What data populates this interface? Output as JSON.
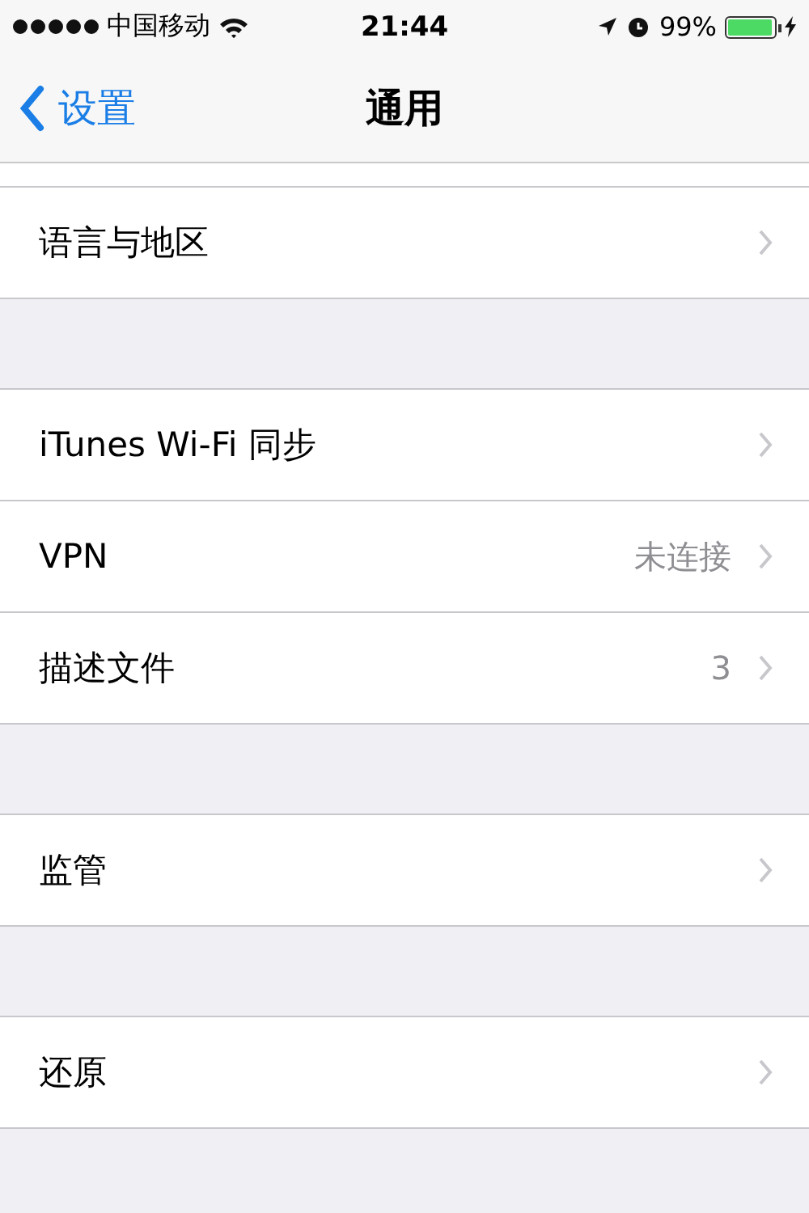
{
  "status_bar": {
    "carrier": "中国移动",
    "time": "21:44",
    "battery_text": "99%",
    "charging": true
  },
  "nav": {
    "back": "设置",
    "title": "通用"
  },
  "groups": [
    {
      "rows": [
        {
          "label": "语言与地区"
        }
      ]
    },
    {
      "rows": [
        {
          "label": "iTunes Wi-Fi 同步"
        },
        {
          "label": "VPN",
          "value": "未连接"
        },
        {
          "label": "描述文件",
          "value": "3"
        }
      ]
    },
    {
      "rows": [
        {
          "label": "监管"
        }
      ]
    },
    {
      "rows": [
        {
          "label": "还原"
        }
      ]
    }
  ]
}
